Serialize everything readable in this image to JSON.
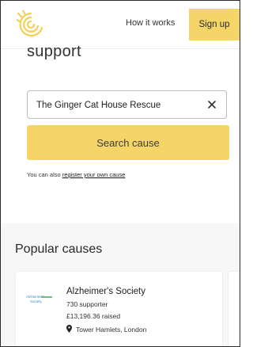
{
  "header": {
    "logo_icon": "sun-rays-logo-icon",
    "nav_how_it_works": "How it works",
    "signup_label": "Sign up",
    "accent_color": "#f5d468"
  },
  "hero": {
    "title": "support",
    "search": {
      "value": "The Ginger Cat House Rescue",
      "clear_icon": "close-icon"
    },
    "search_button_label": "Search cause",
    "register_prefix": "You can also",
    "register_link": "register your own cause"
  },
  "popular": {
    "title": "Popular causes",
    "causes": [
      {
        "logo_text_line1": "Alzheimer's",
        "logo_text_line2": "Society",
        "name": "Alzheimer's Society",
        "supporters": "730 supporter",
        "raised": "£13,196.36 raised",
        "location": "Tower Hamlets, London",
        "location_icon": "map-pin-icon"
      }
    ]
  }
}
